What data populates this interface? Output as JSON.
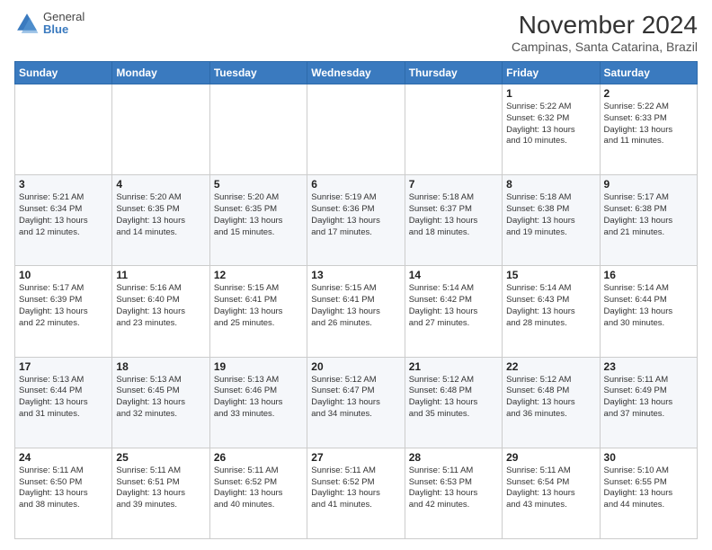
{
  "logo": {
    "general": "General",
    "blue": "Blue"
  },
  "header": {
    "month": "November 2024",
    "location": "Campinas, Santa Catarina, Brazil"
  },
  "weekdays": [
    "Sunday",
    "Monday",
    "Tuesday",
    "Wednesday",
    "Thursday",
    "Friday",
    "Saturday"
  ],
  "weeks": [
    [
      {
        "day": "",
        "info": ""
      },
      {
        "day": "",
        "info": ""
      },
      {
        "day": "",
        "info": ""
      },
      {
        "day": "",
        "info": ""
      },
      {
        "day": "",
        "info": ""
      },
      {
        "day": "1",
        "info": "Sunrise: 5:22 AM\nSunset: 6:32 PM\nDaylight: 13 hours\nand 10 minutes."
      },
      {
        "day": "2",
        "info": "Sunrise: 5:22 AM\nSunset: 6:33 PM\nDaylight: 13 hours\nand 11 minutes."
      }
    ],
    [
      {
        "day": "3",
        "info": "Sunrise: 5:21 AM\nSunset: 6:34 PM\nDaylight: 13 hours\nand 12 minutes."
      },
      {
        "day": "4",
        "info": "Sunrise: 5:20 AM\nSunset: 6:35 PM\nDaylight: 13 hours\nand 14 minutes."
      },
      {
        "day": "5",
        "info": "Sunrise: 5:20 AM\nSunset: 6:35 PM\nDaylight: 13 hours\nand 15 minutes."
      },
      {
        "day": "6",
        "info": "Sunrise: 5:19 AM\nSunset: 6:36 PM\nDaylight: 13 hours\nand 17 minutes."
      },
      {
        "day": "7",
        "info": "Sunrise: 5:18 AM\nSunset: 6:37 PM\nDaylight: 13 hours\nand 18 minutes."
      },
      {
        "day": "8",
        "info": "Sunrise: 5:18 AM\nSunset: 6:38 PM\nDaylight: 13 hours\nand 19 minutes."
      },
      {
        "day": "9",
        "info": "Sunrise: 5:17 AM\nSunset: 6:38 PM\nDaylight: 13 hours\nand 21 minutes."
      }
    ],
    [
      {
        "day": "10",
        "info": "Sunrise: 5:17 AM\nSunset: 6:39 PM\nDaylight: 13 hours\nand 22 minutes."
      },
      {
        "day": "11",
        "info": "Sunrise: 5:16 AM\nSunset: 6:40 PM\nDaylight: 13 hours\nand 23 minutes."
      },
      {
        "day": "12",
        "info": "Sunrise: 5:15 AM\nSunset: 6:41 PM\nDaylight: 13 hours\nand 25 minutes."
      },
      {
        "day": "13",
        "info": "Sunrise: 5:15 AM\nSunset: 6:41 PM\nDaylight: 13 hours\nand 26 minutes."
      },
      {
        "day": "14",
        "info": "Sunrise: 5:14 AM\nSunset: 6:42 PM\nDaylight: 13 hours\nand 27 minutes."
      },
      {
        "day": "15",
        "info": "Sunrise: 5:14 AM\nSunset: 6:43 PM\nDaylight: 13 hours\nand 28 minutes."
      },
      {
        "day": "16",
        "info": "Sunrise: 5:14 AM\nSunset: 6:44 PM\nDaylight: 13 hours\nand 30 minutes."
      }
    ],
    [
      {
        "day": "17",
        "info": "Sunrise: 5:13 AM\nSunset: 6:44 PM\nDaylight: 13 hours\nand 31 minutes."
      },
      {
        "day": "18",
        "info": "Sunrise: 5:13 AM\nSunset: 6:45 PM\nDaylight: 13 hours\nand 32 minutes."
      },
      {
        "day": "19",
        "info": "Sunrise: 5:13 AM\nSunset: 6:46 PM\nDaylight: 13 hours\nand 33 minutes."
      },
      {
        "day": "20",
        "info": "Sunrise: 5:12 AM\nSunset: 6:47 PM\nDaylight: 13 hours\nand 34 minutes."
      },
      {
        "day": "21",
        "info": "Sunrise: 5:12 AM\nSunset: 6:48 PM\nDaylight: 13 hours\nand 35 minutes."
      },
      {
        "day": "22",
        "info": "Sunrise: 5:12 AM\nSunset: 6:48 PM\nDaylight: 13 hours\nand 36 minutes."
      },
      {
        "day": "23",
        "info": "Sunrise: 5:11 AM\nSunset: 6:49 PM\nDaylight: 13 hours\nand 37 minutes."
      }
    ],
    [
      {
        "day": "24",
        "info": "Sunrise: 5:11 AM\nSunset: 6:50 PM\nDaylight: 13 hours\nand 38 minutes."
      },
      {
        "day": "25",
        "info": "Sunrise: 5:11 AM\nSunset: 6:51 PM\nDaylight: 13 hours\nand 39 minutes."
      },
      {
        "day": "26",
        "info": "Sunrise: 5:11 AM\nSunset: 6:52 PM\nDaylight: 13 hours\nand 40 minutes."
      },
      {
        "day": "27",
        "info": "Sunrise: 5:11 AM\nSunset: 6:52 PM\nDaylight: 13 hours\nand 41 minutes."
      },
      {
        "day": "28",
        "info": "Sunrise: 5:11 AM\nSunset: 6:53 PM\nDaylight: 13 hours\nand 42 minutes."
      },
      {
        "day": "29",
        "info": "Sunrise: 5:11 AM\nSunset: 6:54 PM\nDaylight: 13 hours\nand 43 minutes."
      },
      {
        "day": "30",
        "info": "Sunrise: 5:10 AM\nSunset: 6:55 PM\nDaylight: 13 hours\nand 44 minutes."
      }
    ]
  ]
}
